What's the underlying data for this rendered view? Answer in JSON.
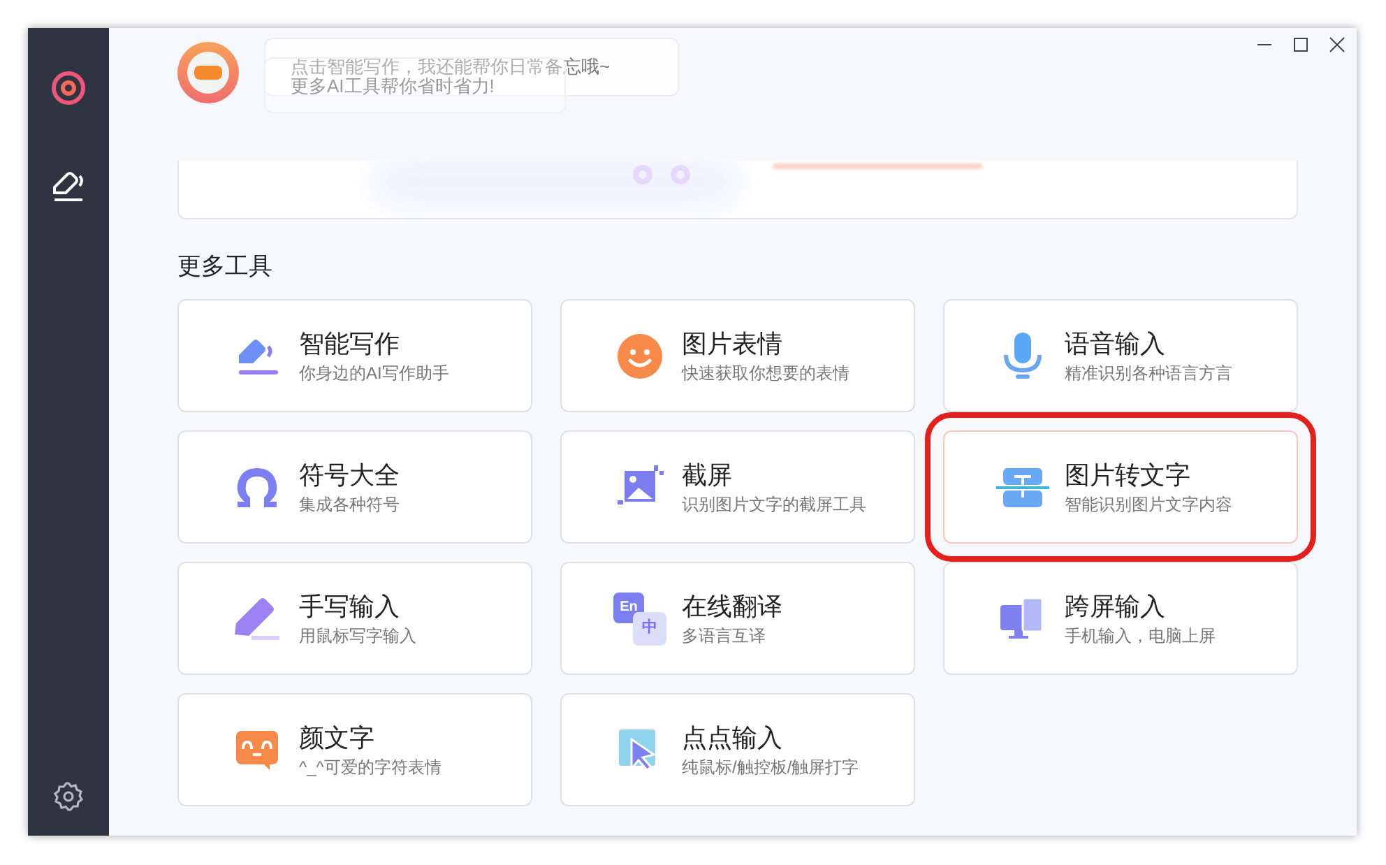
{
  "sidebar": {
    "items": [
      {
        "kind": "target",
        "selected": false
      },
      {
        "kind": "pen",
        "selected": true
      }
    ]
  },
  "assistant": {
    "bubbles": [
      "点击智能写作，我还能帮你日常备忘哦~",
      "更多AI工具帮你省时省力!"
    ]
  },
  "section_title": "更多工具",
  "tools": [
    {
      "kind": "write",
      "title": "智能写作",
      "subtitle": "你身边的AI写作助手",
      "highlighted": false
    },
    {
      "kind": "emoji",
      "title": "图片表情",
      "subtitle": "快速获取你想要的表情",
      "highlighted": false
    },
    {
      "kind": "mic",
      "title": "语音输入",
      "subtitle": "精准识别各种语言方言",
      "highlighted": false
    },
    {
      "kind": "omega",
      "title": "符号大全",
      "subtitle": "集成各种符号",
      "highlighted": false
    },
    {
      "kind": "screenshot",
      "title": "截屏",
      "subtitle": "识别图片文字的截屏工具",
      "highlighted": false
    },
    {
      "kind": "ocr",
      "title": "图片转文字",
      "subtitle": "智能识别图片文字内容",
      "highlighted": true
    },
    {
      "kind": "pencil",
      "title": "手写输入",
      "subtitle": "用鼠标写字输入",
      "highlighted": false
    },
    {
      "kind": "translate",
      "title": "在线翻译",
      "subtitle": "多语言互译",
      "highlighted": false,
      "badges": [
        "En",
        "中"
      ]
    },
    {
      "kind": "screens",
      "title": "跨屏输入",
      "subtitle": "手机输入，电脑上屏",
      "highlighted": false
    },
    {
      "kind": "kaomoji",
      "title": "颜文字",
      "subtitle": "^_^可爱的字符表情",
      "highlighted": false
    },
    {
      "kind": "click",
      "title": "点点输入",
      "subtitle": "纯鼠标/触控板/触屏打字",
      "highlighted": false
    }
  ]
}
